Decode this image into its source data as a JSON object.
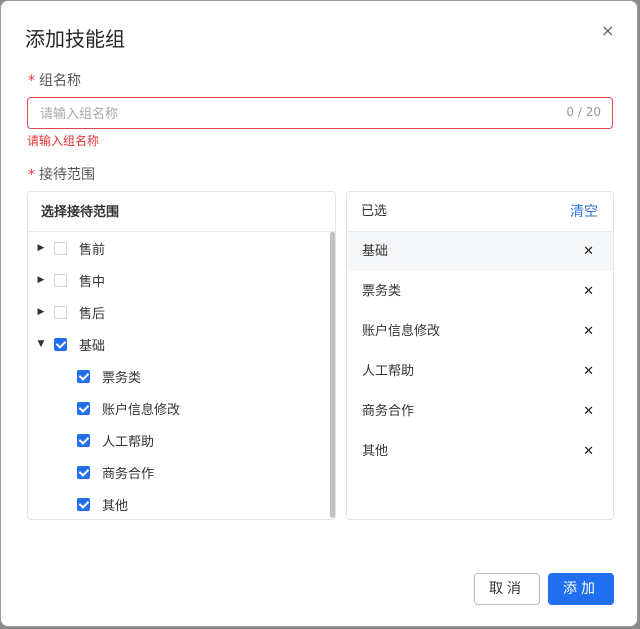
{
  "dialog": {
    "title": "添加技能组",
    "close_glyph": "×"
  },
  "form": {
    "required_mark": "*",
    "group_name": {
      "label": "组名称",
      "placeholder": "请输入组名称",
      "value": "",
      "counter": "0 / 20",
      "error": "请输入组名称"
    },
    "scope": {
      "label": "接待范围"
    }
  },
  "tree_panel": {
    "header": "选择接待范围",
    "nodes": [
      {
        "label": "售前",
        "checked": false,
        "expanded": false,
        "arrow": "▶"
      },
      {
        "label": "售中",
        "checked": false,
        "expanded": false,
        "arrow": "▶"
      },
      {
        "label": "售后",
        "checked": false,
        "expanded": false,
        "arrow": "▶"
      },
      {
        "label": "基础",
        "checked": true,
        "expanded": true,
        "arrow": "▼",
        "children": [
          {
            "label": "票务类",
            "checked": true
          },
          {
            "label": "账户信息修改",
            "checked": true
          },
          {
            "label": "人工帮助",
            "checked": true
          },
          {
            "label": "商务合作",
            "checked": true
          },
          {
            "label": "其他",
            "checked": true
          }
        ]
      }
    ]
  },
  "selected_panel": {
    "header": "已选",
    "clear_label": "清空",
    "remove_glyph": "✕",
    "items": [
      {
        "label": "基础",
        "highlighted": true
      },
      {
        "label": "票务类",
        "highlighted": false
      },
      {
        "label": "账户信息修改",
        "highlighted": false
      },
      {
        "label": "人工帮助",
        "highlighted": false
      },
      {
        "label": "商务合作",
        "highlighted": false
      },
      {
        "label": "其他",
        "highlighted": false
      }
    ]
  },
  "footer": {
    "cancel_label": "取消",
    "submit_label": "添加"
  },
  "colors": {
    "primary": "#1f6ff0",
    "error": "#e5363a",
    "link": "#2e77d0"
  }
}
